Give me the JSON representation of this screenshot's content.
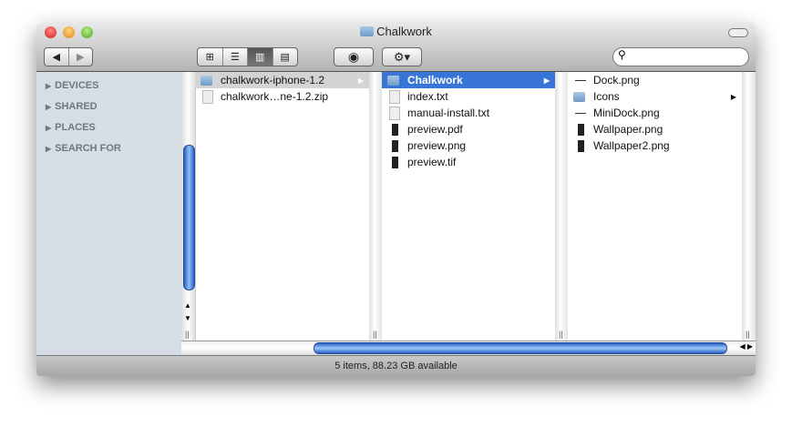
{
  "window": {
    "title": "Chalkwork"
  },
  "toolbar": {
    "back": "◀",
    "forward": "▶",
    "views": [
      "icon-view",
      "list-view",
      "column-view",
      "cover-flow-view"
    ],
    "quicklook": "quick-look",
    "action": "action-menu",
    "search_placeholder": ""
  },
  "sidebar": {
    "sections": [
      "DEVICES",
      "SHARED",
      "PLACES",
      "SEARCH FOR"
    ]
  },
  "columns": [
    [
      {
        "name": "chalkwork-iphone-1.2",
        "icon": "folder",
        "folder": true,
        "state": "path"
      },
      {
        "name": "chalkwork…ne-1.2.zip",
        "icon": "zip"
      }
    ],
    [
      {
        "name": "Chalkwork",
        "icon": "folder",
        "folder": true,
        "state": "selected"
      },
      {
        "name": "index.txt",
        "icon": "doc"
      },
      {
        "name": "manual-install.txt",
        "icon": "doc"
      },
      {
        "name": "preview.pdf",
        "icon": "black"
      },
      {
        "name": "preview.png",
        "icon": "black"
      },
      {
        "name": "preview.tif",
        "icon": "black"
      }
    ],
    [
      {
        "name": "Dock.png",
        "icon": "dash"
      },
      {
        "name": "Icons",
        "icon": "folder",
        "folder": true
      },
      {
        "name": "MiniDock.png",
        "icon": "dash"
      },
      {
        "name": "Wallpaper.png",
        "icon": "black"
      },
      {
        "name": "Wallpaper2.png",
        "icon": "black"
      }
    ]
  ],
  "status": {
    "text": "5 items, 88.23 GB available"
  }
}
